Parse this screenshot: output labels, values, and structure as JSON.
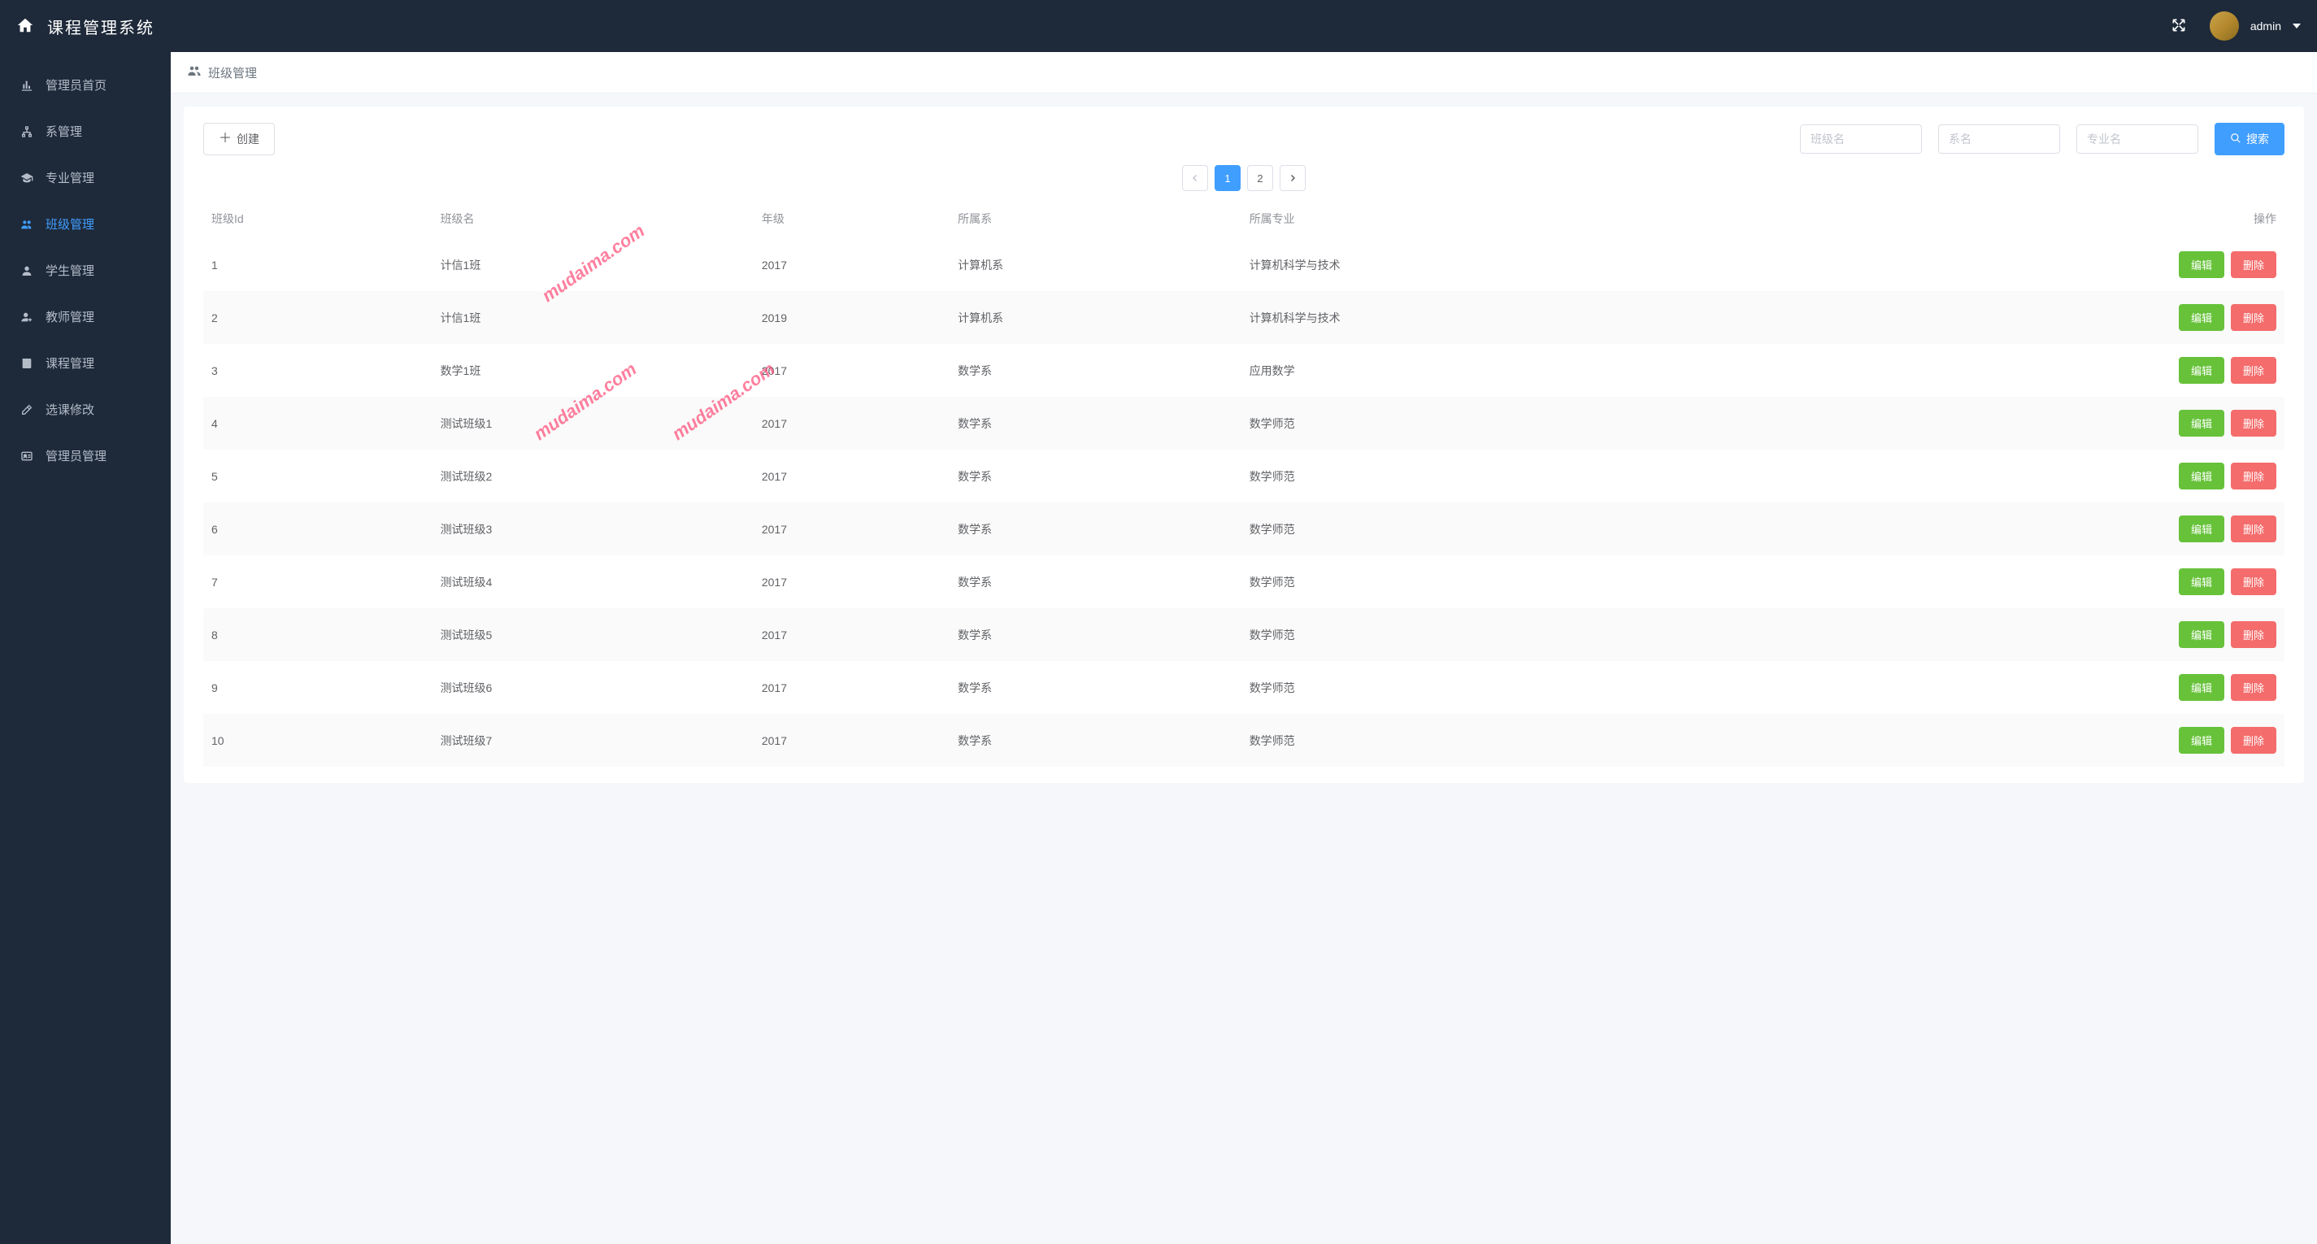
{
  "header": {
    "title": "课程管理系统",
    "user_name": "admin"
  },
  "sidebar": {
    "items": [
      {
        "label": "管理员首页",
        "icon": "bar-chart"
      },
      {
        "label": "系管理",
        "icon": "sitemap"
      },
      {
        "label": "专业管理",
        "icon": "graduation"
      },
      {
        "label": "班级管理",
        "icon": "users",
        "active": true
      },
      {
        "label": "学生管理",
        "icon": "user"
      },
      {
        "label": "教师管理",
        "icon": "user-plus"
      },
      {
        "label": "课程管理",
        "icon": "book"
      },
      {
        "label": "选课修改",
        "icon": "edit"
      },
      {
        "label": "管理员管理",
        "icon": "id-card"
      }
    ]
  },
  "breadcrumb": {
    "label": "班级管理"
  },
  "toolbar": {
    "create_label": "创建",
    "search_label": "搜索",
    "filter_class_placeholder": "班级名",
    "filter_dept_placeholder": "系名",
    "filter_major_placeholder": "专业名"
  },
  "pagination": {
    "pages": [
      "1",
      "2"
    ],
    "active": "1"
  },
  "table": {
    "columns": [
      "班级Id",
      "班级名",
      "年级",
      "所属系",
      "所属专业",
      "操作"
    ],
    "edit_label": "编辑",
    "delete_label": "删除",
    "rows": [
      {
        "id": "1",
        "name": "计信1班",
        "year": "2017",
        "dept": "计算机系",
        "major": "计算机科学与技术"
      },
      {
        "id": "2",
        "name": "计信1班",
        "year": "2019",
        "dept": "计算机系",
        "major": "计算机科学与技术"
      },
      {
        "id": "3",
        "name": "数学1班",
        "year": "2017",
        "dept": "数学系",
        "major": "应用数学"
      },
      {
        "id": "4",
        "name": "测试班级1",
        "year": "2017",
        "dept": "数学系",
        "major": "数学师范"
      },
      {
        "id": "5",
        "name": "测试班级2",
        "year": "2017",
        "dept": "数学系",
        "major": "数学师范"
      },
      {
        "id": "6",
        "name": "测试班级3",
        "year": "2017",
        "dept": "数学系",
        "major": "数学师范"
      },
      {
        "id": "7",
        "name": "测试班级4",
        "year": "2017",
        "dept": "数学系",
        "major": "数学师范"
      },
      {
        "id": "8",
        "name": "测试班级5",
        "year": "2017",
        "dept": "数学系",
        "major": "数学师范"
      },
      {
        "id": "9",
        "name": "测试班级6",
        "year": "2017",
        "dept": "数学系",
        "major": "数学师范"
      },
      {
        "id": "10",
        "name": "测试班级7",
        "year": "2017",
        "dept": "数学系",
        "major": "数学师范"
      }
    ]
  },
  "watermark_text": "mudaima.com"
}
